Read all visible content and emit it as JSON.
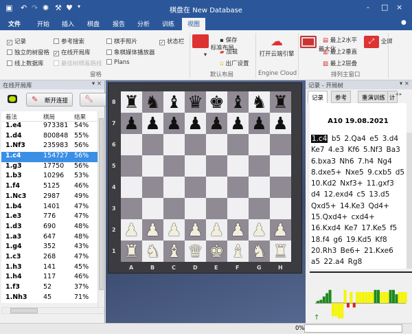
{
  "window": {
    "title": "棋盘在 New Database",
    "minimize": "-",
    "maximize": "□",
    "close": "×"
  },
  "ribbon_tabs": [
    "文件",
    "开始",
    "插入",
    "棋盘",
    "报告",
    "分析",
    "训练",
    "视图"
  ],
  "active_tab": "视图",
  "panes_group": {
    "label": "窗格",
    "checkboxes": [
      {
        "label": "记录",
        "checked": true,
        "enabled": true
      },
      {
        "label": "独立的树窗格",
        "checked": false,
        "enabled": true
      },
      {
        "label": "线上数据库",
        "checked": false,
        "enabled": true
      },
      {
        "label": "参考搜索",
        "checked": false,
        "enabled": true
      },
      {
        "label": "在线开局库",
        "checked": true,
        "enabled": true
      },
      {
        "label": "最佳树棋着路线",
        "checked": false,
        "enabled": false
      },
      {
        "label": "棋手照片",
        "checked": false,
        "enabled": true
      },
      {
        "label": "象棋媒体播放器",
        "checked": false,
        "enabled": true
      },
      {
        "label": "Plans",
        "checked": false,
        "enabled": true
      },
      {
        "label": "状态栏",
        "checked": true,
        "enabled": true
      }
    ]
  },
  "layout_group": {
    "label": "默认布局",
    "standard": "标准布局",
    "save": "保存",
    "load": "加载",
    "factory": "出厂设置"
  },
  "cloud_group": {
    "label": "Engine Cloud",
    "open": "打开云端引擎"
  },
  "arrange_group": {
    "label": "排列主窗口",
    "maximize": "最大化",
    "top2h": "最上2水平",
    "top2v": "最上2垂直",
    "top2c": "最上2层叠",
    "fullscreen": "全屏"
  },
  "opening_book": {
    "title": "在线开局库",
    "disconnect": "断开连接",
    "columns": [
      "着法",
      "棋局",
      "结果"
    ],
    "rows": [
      [
        "1.e4",
        "973381",
        "54%"
      ],
      [
        "1.d4",
        "800848",
        "55%"
      ],
      [
        "1.Nf3",
        "235983",
        "56%"
      ],
      [
        "1.c4",
        "154727",
        "56%"
      ],
      [
        "1.g3",
        "17750",
        "56%"
      ],
      [
        "1.b3",
        "10296",
        "53%"
      ],
      [
        "1.f4",
        "5125",
        "46%"
      ],
      [
        "1.Nc3",
        "2987",
        "49%"
      ],
      [
        "1.b4",
        "1401",
        "47%"
      ],
      [
        "1.e3",
        "776",
        "47%"
      ],
      [
        "1.d3",
        "690",
        "48%"
      ],
      [
        "1.a3",
        "647",
        "48%"
      ],
      [
        "1.g4",
        "352",
        "43%"
      ],
      [
        "1.c3",
        "268",
        "47%"
      ],
      [
        "1.h3",
        "141",
        "45%"
      ],
      [
        "1.h4",
        "117",
        "46%"
      ],
      [
        "1.f3",
        "52",
        "37%"
      ],
      [
        "1.Nh3",
        "45",
        "71%"
      ]
    ],
    "selected_row": 3
  },
  "board": {
    "files": [
      "A",
      "B",
      "C",
      "D",
      "E",
      "F",
      "G",
      "H"
    ],
    "ranks": [
      "8",
      "7",
      "6",
      "5",
      "4",
      "3",
      "2",
      "1"
    ],
    "position": [
      "rnbqkbnr",
      "pppppppp",
      "8",
      "8",
      "8",
      "8",
      "PPPPPPPP",
      "RNBQKBNR"
    ]
  },
  "notation_panel": {
    "title": "记录 - 开局树",
    "tabs": [
      "记录",
      "参考",
      "重演训练",
      "计"
    ],
    "header": "A10  19.08.2021",
    "first_move": "1.c4",
    "moves": "b5 2.Qa4 e5 3.d4 Ke7 4.e3 Kf6 5.Nf3 Ba3 6.bxa3 Nh6 7.h4 Ng4 8.dxe5+ Nxe5 9.cxb5 d5 10.Kd2 Nxf3+ 11.gxf3 d4 12.exd4 c5 13.d5 Qxd5+ 14.Ke3 Qd4+ 15.Qxd4+ cxd4+ 16.Kxd4 Ke7 17.Ke5 f5 18.f4 g6 19.Kd5 Kf8 20.Rh3 Be6+ 21.Kxe6 a5 22.a4 Rg8"
  },
  "status": {
    "progress": "0%",
    "progress_value": 0
  },
  "colors": {
    "titlebar": "#2b579a",
    "selection": "#3a8ee6",
    "eval_yellow": "#f5f500",
    "eval_green": "#1e8a1e",
    "eval_red": "#e02020"
  }
}
